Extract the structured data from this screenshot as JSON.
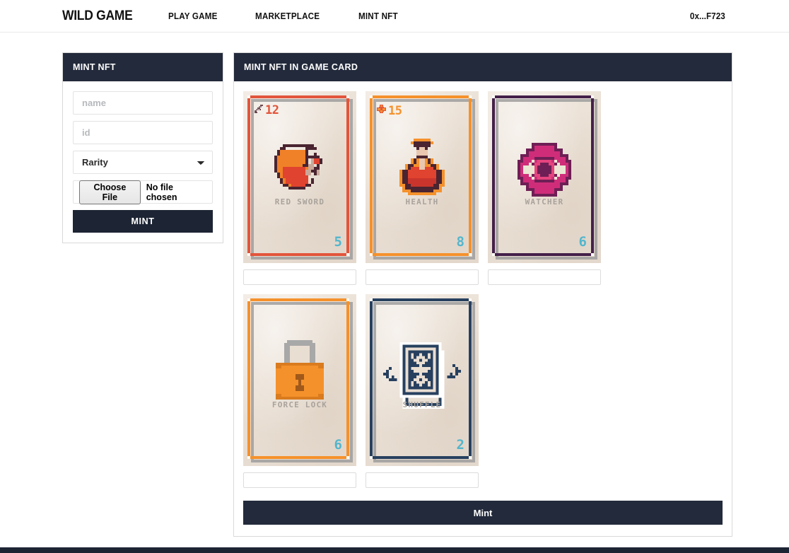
{
  "navbar": {
    "brand": "WILD GAME",
    "links": [
      {
        "label": "PLAY GAME",
        "name": "nav-play-game"
      },
      {
        "label": "MARKETPLACE",
        "name": "nav-marketplace"
      },
      {
        "label": "MINT NFT",
        "name": "nav-mint-nft"
      }
    ],
    "wallet": "0x...F723"
  },
  "mint_form": {
    "title": "MINT NFT",
    "name_placeholder": "name",
    "name_value": "",
    "id_placeholder": "id",
    "id_value": "",
    "rarity_selected": "Rarity",
    "rarity_options": [
      "Rarity"
    ],
    "file_button": "Choose File",
    "file_status": "No file chosen",
    "submit_label": "MINT"
  },
  "cards_panel": {
    "title": "MINT NFT IN GAME CARD",
    "mint_label": "Mint",
    "input_placeholder": "",
    "cards": [
      {
        "name": "RED SWORD",
        "stat_value": "12",
        "stat_icon": "sword-icon",
        "cost": "5",
        "frame_color": "#e2553b",
        "art": "red-sword-art"
      },
      {
        "name": "HEALTH",
        "stat_value": "15",
        "stat_icon": "health-cross-icon",
        "cost": "8",
        "frame_color": "#f5912b",
        "art": "health-potion-art"
      },
      {
        "name": "WATCHER",
        "stat_value": "",
        "stat_icon": "",
        "cost": "6",
        "frame_color": "#44204a",
        "art": "watcher-eye-art"
      },
      {
        "name": "FORCE LOCK",
        "stat_value": "",
        "stat_icon": "",
        "cost": "6",
        "frame_color": "#f5912b",
        "art": "force-lock-art"
      },
      {
        "name": "SHUFFLE",
        "stat_value": "",
        "stat_icon": "",
        "cost": "2",
        "frame_color": "#27405f",
        "art": "shuffle-deck-art"
      }
    ]
  },
  "colors": {
    "dark_panel": "#222a3b",
    "cost_blue": "#52b6cd",
    "card_paper": "#e9ded2",
    "card_name_gray": "#a9a39c"
  }
}
